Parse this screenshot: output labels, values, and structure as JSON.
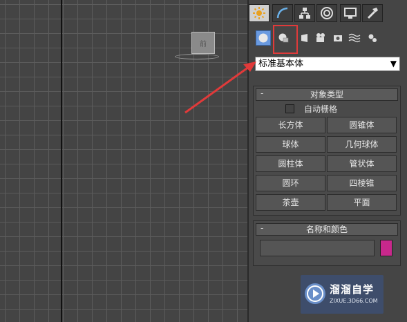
{
  "viewport": {
    "viewcube_label": "前"
  },
  "command_panel": {
    "tabs": [
      "create-tab",
      "modify-tab",
      "hierarchy-tab",
      "motion-tab",
      "display-tab",
      "utilities-tab"
    ],
    "categories": [
      "geometry",
      "shapes",
      "lights",
      "cameras",
      "helpers",
      "space-warps",
      "systems"
    ],
    "dropdown": {
      "selected": "标准基本体"
    },
    "object_type": {
      "title": "对象类型",
      "collapse_symbol": "-",
      "autogrid_label": "自动栅格",
      "autogrid_checked": false,
      "buttons": [
        "长方体",
        "圆锥体",
        "球体",
        "几何球体",
        "圆柱体",
        "管状体",
        "圆环",
        "四棱锥",
        "茶壶",
        "平面"
      ]
    },
    "name_and_color": {
      "title": "名称和颜色",
      "collapse_symbol": "-",
      "name_value": "",
      "color": "#c8288c"
    }
  },
  "watermark": {
    "title": "溜溜自学",
    "url": "ZIXUE.3D66.COM"
  },
  "colors": {
    "accent_red": "#e03a3a",
    "active_category": "#6a9ae0",
    "object_color": "#c8288c"
  }
}
